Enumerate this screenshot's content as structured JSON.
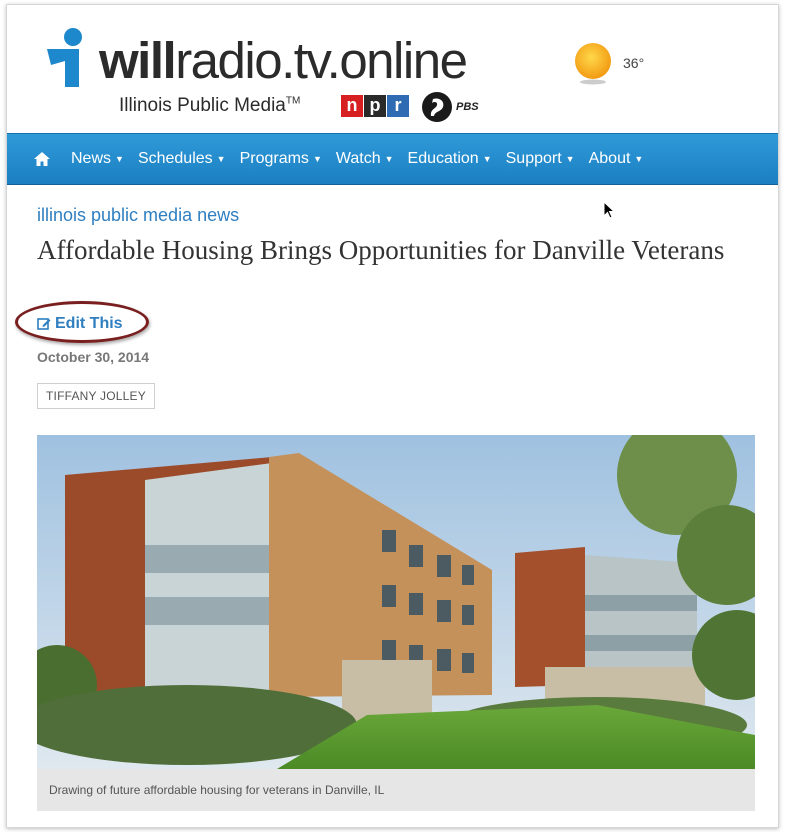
{
  "header": {
    "logo_will": "will",
    "logo_rest": "radio.tv.online",
    "logo_sub": "Illinois Public Media",
    "logo_tm": "TM",
    "npr": [
      "n",
      "p",
      "r"
    ],
    "pbs": "PBS",
    "weather_icon": "sun-icon",
    "temperature": "36°"
  },
  "nav": {
    "home_icon": "home-icon",
    "items": [
      {
        "label": "News"
      },
      {
        "label": "Schedules"
      },
      {
        "label": "Programs"
      },
      {
        "label": "Watch"
      },
      {
        "label": "Education"
      },
      {
        "label": "Support"
      },
      {
        "label": "About"
      }
    ]
  },
  "article": {
    "kicker": "illinois public media news",
    "title": "Affordable Housing Brings Opportunities for Danville Veterans",
    "edit_label": "Edit This",
    "date": "October 30, 2014",
    "byline": "TIFFANY JOLLEY",
    "image_caption": "Drawing of future affordable housing for veterans in Danville, IL"
  },
  "colors": {
    "nav_blue": "#2f9ad8",
    "link_blue": "#2f7fc0",
    "annotation_red": "#7a1f1f"
  }
}
